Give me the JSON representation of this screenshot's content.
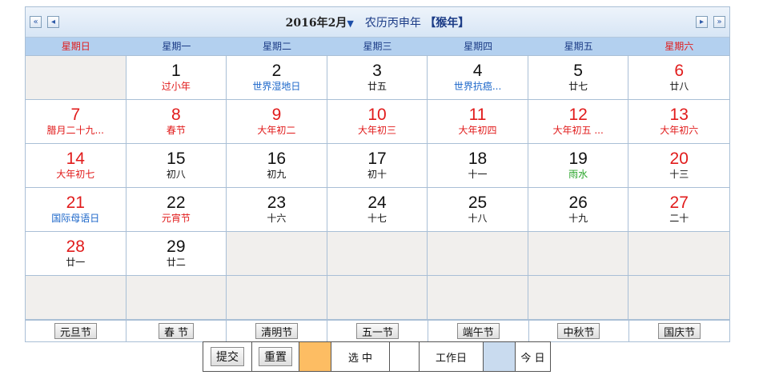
{
  "header": {
    "year_month": "2016年2月",
    "arrow": "▼",
    "lunar": "农历丙申年",
    "zodiac": "【猴年】",
    "nav": {
      "prev_year": "«",
      "prev_month": "◂",
      "next_month": "▸",
      "next_year": "»"
    }
  },
  "weekdays": [
    "星期日",
    "星期一",
    "星期二",
    "星期三",
    "星期四",
    "星期五",
    "星期六"
  ],
  "colors": {
    "red": "#e11b1b",
    "blue": "#1b66c9",
    "green": "#2aa52a",
    "selected": "#fdbd63",
    "today": "#c9dbef"
  },
  "days": [
    {
      "num": "",
      "sub": "",
      "num_color": "black",
      "sub_color": "black"
    },
    {
      "num": "1",
      "sub": "过小年",
      "num_color": "black",
      "sub_color": "red"
    },
    {
      "num": "2",
      "sub": "世界湿地日",
      "num_color": "black",
      "sub_color": "blue"
    },
    {
      "num": "3",
      "sub": "廿五",
      "num_color": "black",
      "sub_color": "black"
    },
    {
      "num": "4",
      "sub": "世界抗癌...",
      "num_color": "black",
      "sub_color": "blue"
    },
    {
      "num": "5",
      "sub": "廿七",
      "num_color": "black",
      "sub_color": "black"
    },
    {
      "num": "6",
      "sub": "廿八",
      "num_color": "red",
      "sub_color": "black"
    },
    {
      "num": "7",
      "sub": "腊月二十九...",
      "num_color": "red",
      "sub_color": "red"
    },
    {
      "num": "8",
      "sub": "春节",
      "num_color": "red",
      "sub_color": "red"
    },
    {
      "num": "9",
      "sub": "大年初二",
      "num_color": "red",
      "sub_color": "red"
    },
    {
      "num": "10",
      "sub": "大年初三",
      "num_color": "red",
      "sub_color": "red"
    },
    {
      "num": "11",
      "sub": "大年初四",
      "num_color": "red",
      "sub_color": "red"
    },
    {
      "num": "12",
      "sub": "大年初五 ...",
      "num_color": "red",
      "sub_color": "red"
    },
    {
      "num": "13",
      "sub": "大年初六",
      "num_color": "red",
      "sub_color": "red"
    },
    {
      "num": "14",
      "sub": "大年初七",
      "num_color": "red",
      "sub_color": "red"
    },
    {
      "num": "15",
      "sub": "初八",
      "num_color": "black",
      "sub_color": "black"
    },
    {
      "num": "16",
      "sub": "初九",
      "num_color": "black",
      "sub_color": "black"
    },
    {
      "num": "17",
      "sub": "初十",
      "num_color": "black",
      "sub_color": "black"
    },
    {
      "num": "18",
      "sub": "十一",
      "num_color": "black",
      "sub_color": "black"
    },
    {
      "num": "19",
      "sub": "雨水",
      "num_color": "black",
      "sub_color": "green"
    },
    {
      "num": "20",
      "sub": "十三",
      "num_color": "red",
      "sub_color": "black"
    },
    {
      "num": "21",
      "sub": "国际母语日",
      "num_color": "red",
      "sub_color": "blue"
    },
    {
      "num": "22",
      "sub": "元宵节",
      "num_color": "black",
      "sub_color": "red"
    },
    {
      "num": "23",
      "sub": "十六",
      "num_color": "black",
      "sub_color": "black"
    },
    {
      "num": "24",
      "sub": "十七",
      "num_color": "black",
      "sub_color": "black"
    },
    {
      "num": "25",
      "sub": "十八",
      "num_color": "black",
      "sub_color": "black"
    },
    {
      "num": "26",
      "sub": "十九",
      "num_color": "black",
      "sub_color": "black"
    },
    {
      "num": "27",
      "sub": "二十",
      "num_color": "red",
      "sub_color": "black"
    },
    {
      "num": "28",
      "sub": "廿一",
      "num_color": "red",
      "sub_color": "black"
    },
    {
      "num": "29",
      "sub": "廿二",
      "num_color": "black",
      "sub_color": "black"
    }
  ],
  "festivals": [
    "元旦节",
    "春 节",
    "清明节",
    "五一节",
    "端午节",
    "中秋节",
    "国庆节"
  ],
  "footer": {
    "submit": "提交",
    "reset": "重置",
    "selected_label": "选 中",
    "workday_label": "工作日",
    "today_label": "今 日"
  }
}
